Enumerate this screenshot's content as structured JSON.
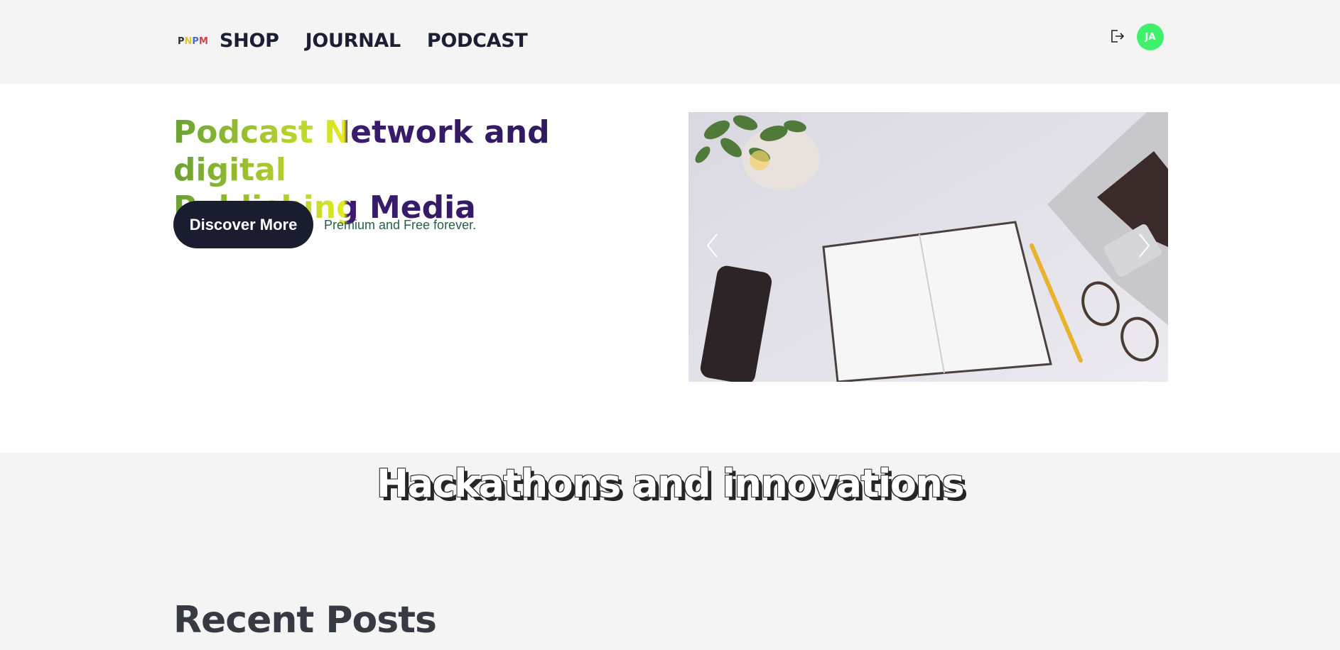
{
  "header": {
    "logo_letters": [
      "P",
      "N",
      "P",
      "M"
    ],
    "nav": [
      {
        "label": "SHOP"
      },
      {
        "label": "JOURNAL"
      },
      {
        "label": "PODCAST"
      }
    ],
    "avatar_initials": "JA",
    "avatar_color": "#3ff06a",
    "logout_icon": "logout-icon"
  },
  "hero": {
    "title_line1": "Podcast Network and digital",
    "title_line2": "Publishing Media",
    "button_label": "Discover More",
    "tagline": "Premium and Free forever.",
    "button_color": "#1a1d30"
  },
  "carousel": {
    "prev_icon": "chevron-left-icon",
    "next_icon": "chevron-right-icon"
  },
  "section": {
    "title": "Hackathons and innovations"
  },
  "recent": {
    "title": "Recent Posts"
  }
}
